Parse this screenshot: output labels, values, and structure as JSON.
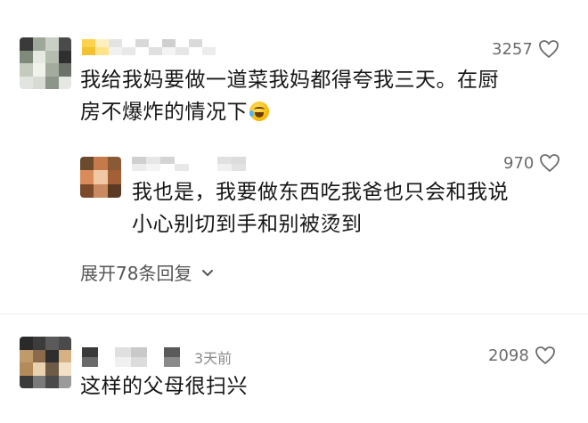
{
  "comments": [
    {
      "likes": "3257",
      "text_line1": "我给我妈要做一道菜我妈都得夸我三天。在厨",
      "text_line2": "房不爆炸的情况下"
    }
  ],
  "reply": {
    "likes": "970",
    "text_line1": "我也是，我要做东西吃我爸也只会和我说",
    "text_line2": "小心别切到手和别被烫到"
  },
  "expand_label": "展开78条回复",
  "second_comment": {
    "time": "3天前",
    "likes": "2098",
    "text": "这样的父母很扫兴"
  },
  "icons": {
    "like": "heart-outline-icon",
    "expand": "chevron-down-icon"
  },
  "colors": {
    "text": "#161616",
    "meta": "#6b6b6b",
    "background": "#ffffff"
  }
}
